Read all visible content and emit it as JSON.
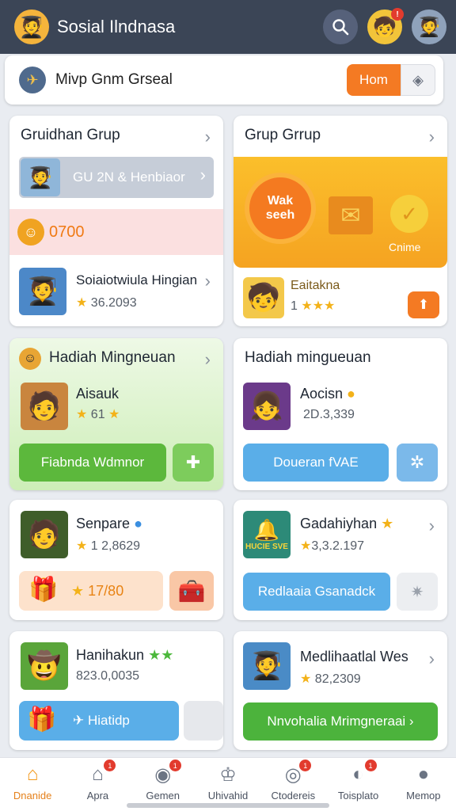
{
  "header": {
    "title": "Sosial Ilndnasa",
    "notification_badge": "!"
  },
  "search": {
    "text": "Mivp Gnm Grseal",
    "home_label": "Hom",
    "toggle_icon": "toggle-icon"
  },
  "cards": {
    "c1": {
      "title": "Gruidhan Grup",
      "banner": "GU 2N & Henbiaor",
      "coins": "0700",
      "name": "Soiaiotwiula Hingian",
      "score": "36.2093"
    },
    "c2": {
      "title": "Grup Grrup",
      "badge_line1": "Wak",
      "badge_line2": "seeh",
      "promo_label": "Cnime",
      "name": "Eaitakna",
      "stars": "1"
    },
    "c3": {
      "title": "Hadiah Mingneuan",
      "name": "Aisauk",
      "score": "61",
      "button": "Fiabnda Wdmnor"
    },
    "c4": {
      "title": "Hadiah mingueuan",
      "name": "Aocisn",
      "score": "2D.3,339",
      "button": "Doueran fVAE"
    },
    "c5": {
      "title": "",
      "name": "Senpare",
      "score": "1 2,8629",
      "gift_value": "17/80"
    },
    "c6": {
      "title": "",
      "name": "Gadahiyhan",
      "score": "3,3.2.197",
      "tile_label": "HUCIE SVE",
      "button": "Redlaaia Gsanadck"
    },
    "c7": {
      "title": "",
      "name": "Hanihakun",
      "score": "823.0,0035",
      "button": "Hiatidp"
    },
    "c8": {
      "title": "",
      "name": "Medlihaatlal Wes",
      "score": "82,2309",
      "button": "Nnvohalia Mrimgneraai"
    }
  },
  "nav": [
    {
      "label": "Dnanide",
      "icon": "home-icon",
      "active": true
    },
    {
      "label": "Apra",
      "icon": "camera-icon",
      "badge": "1"
    },
    {
      "label": "Gemen",
      "icon": "gamepad-icon",
      "badge": "1"
    },
    {
      "label": "Uhivahid",
      "icon": "crown-icon"
    },
    {
      "label": "Ctodereis",
      "icon": "circle-icon",
      "badge": "1"
    },
    {
      "label": "Toisplato",
      "icon": "chat-icon",
      "badge": "1"
    },
    {
      "label": "Memop",
      "icon": "profile-icon"
    }
  ],
  "colors": {
    "header_bg": "#3b4556",
    "accent_orange": "#f47a23",
    "green": "#5cb83c",
    "blue": "#5aaee8"
  }
}
